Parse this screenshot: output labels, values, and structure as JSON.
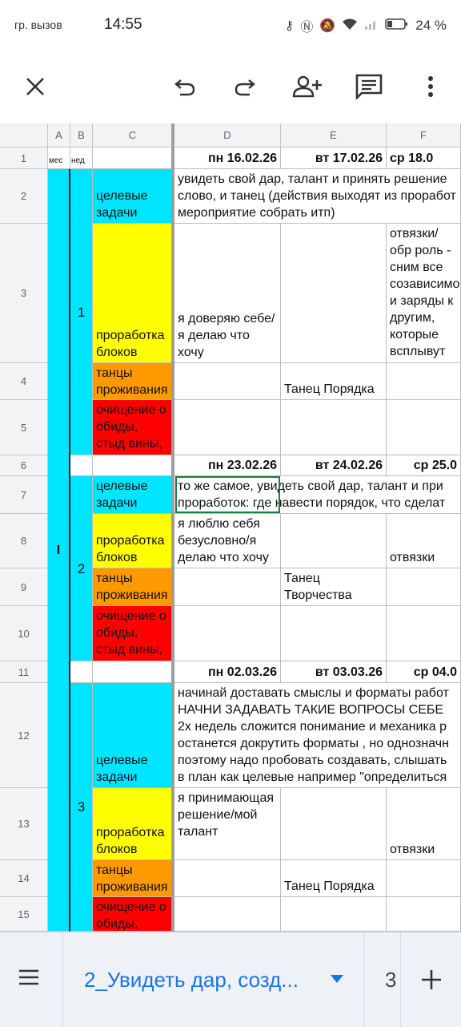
{
  "status": {
    "carrier": "гр. вызов",
    "time": "14:55",
    "battery": "24 %"
  },
  "toolbar": {
    "close": "close-icon",
    "undo": "undo-icon",
    "redo": "redo-icon",
    "share": "add-person-icon",
    "comment": "comment-icon",
    "more": "more-vert-icon"
  },
  "columns": [
    "A",
    "B",
    "C",
    "D",
    "E",
    "F"
  ],
  "rows": [
    "1",
    "2",
    "3",
    "4",
    "5",
    "6",
    "7",
    "8",
    "9",
    "10",
    "11",
    "12",
    "13",
    "14",
    "15"
  ],
  "row1": {
    "a": "мес",
    "b": "нед",
    "d": "пн 16.02.26",
    "e": "вт 17.02.26",
    "f": "ср 18.0"
  },
  "month": "I",
  "weeks": [
    "1",
    "2",
    "3"
  ],
  "labels": {
    "goals": "целевые задачи",
    "blocks": "проработка блоков",
    "dances": "танцы проживания",
    "cleansing": "очищение о обиды, стыд вины, страх"
  },
  "row6": {
    "d": "пн 23.02.26",
    "e": "вт 24.02.26",
    "f": "ср 25.0"
  },
  "row11": {
    "d": "пн 02.03.26",
    "e": "вт 03.03.26",
    "f": "ср 04.0"
  },
  "cells": {
    "r2": "увидеть свой дар, талант и принять решение слово, и танец (действия выходят из проработ мероприятие собрать итп)",
    "r3d": "я доверяю себе/я делаю что хочу",
    "r3f": "отвязки/обр роль - сним все созависимо и заряды к другим, которые всплывут",
    "r4e": "Танец Порядка",
    "r7": "то же самое, увидеть свой дар, талант и при проработок: где навести порядок, что сделат",
    "r8d": "я люблю себя безусловно/я делаю что хочу",
    "r8f": "отвязки",
    "r9e": "Танец Творчества",
    "r12": "начинай доставать смыслы и форматы работ НАЧНИ ЗАДАВАТЬ ТАКИЕ ВОПРОСЫ СЕБЕ 2х недель сложится понимание и механика р останется докрутить форматы , но однозначн поэтому надо пробовать создавать, слышать в план как целевые например \"определиться",
    "r13d": "я принимающая решение/мой талант",
    "r13f": "отвязки",
    "r14e": "Танец Порядка"
  },
  "tabs": {
    "active": "2_Увидеть дар, созд...",
    "next": "3"
  },
  "colors": {
    "cyan": "#00e5ff",
    "yellow": "#ffff00",
    "orange": "#ff9900",
    "red": "#ff0000",
    "accent": "#1a73e8"
  }
}
